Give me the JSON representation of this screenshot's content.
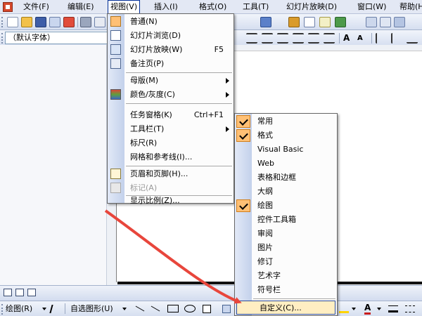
{
  "menubar": {
    "items": [
      {
        "label": "文件(F)"
      },
      {
        "label": "编辑(E)"
      },
      {
        "label": "视图(V)"
      },
      {
        "label": "插入(I)"
      },
      {
        "label": "格式(O)"
      },
      {
        "label": "工具(T)"
      },
      {
        "label": "幻灯片放映(D)"
      },
      {
        "label": "窗口(W)"
      },
      {
        "label": "帮助(H)"
      }
    ]
  },
  "formatting": {
    "font_name": "（默认字体）"
  },
  "view_menu": {
    "items": [
      {
        "label": "普通(N)",
        "shortcut": "",
        "icon": "normal-view-icon"
      },
      {
        "label": "幻灯片浏览(D)",
        "shortcut": "",
        "icon": "slide-sorter-icon"
      },
      {
        "label": "幻灯片放映(W)",
        "shortcut": "F5",
        "icon": "slide-show-icon"
      },
      {
        "label": "备注页(P)",
        "shortcut": "",
        "icon": "notes-page-icon"
      },
      {
        "label": "母版(M)",
        "shortcut": "",
        "icon": ""
      },
      {
        "label": "颜色/灰度(C)",
        "shortcut": "",
        "icon": "color-grayscale-icon"
      },
      {
        "label": "任务窗格(K)",
        "shortcut": "Ctrl+F1",
        "icon": ""
      },
      {
        "label": "工具栏(T)",
        "shortcut": "",
        "icon": ""
      },
      {
        "label": "标尺(R)",
        "shortcut": "",
        "icon": ""
      },
      {
        "label": "网格和参考线(I)...",
        "shortcut": "",
        "icon": ""
      },
      {
        "label": "页眉和页脚(H)...",
        "shortcut": "",
        "icon": "header-footer-icon"
      },
      {
        "label": "标记(A)",
        "shortcut": "",
        "icon": "markup-icon"
      },
      {
        "label": "显示比例(Z)...",
        "shortcut": "",
        "icon": ""
      }
    ]
  },
  "toolbars_submenu": {
    "items": [
      {
        "label": "常用",
        "checked": true
      },
      {
        "label": "格式",
        "checked": true
      },
      {
        "label": "Visual Basic",
        "checked": false
      },
      {
        "label": "Web",
        "checked": false
      },
      {
        "label": "表格和边框",
        "checked": false
      },
      {
        "label": "大纲",
        "checked": false
      },
      {
        "label": "绘图",
        "checked": true
      },
      {
        "label": "控件工具箱",
        "checked": false
      },
      {
        "label": "审阅",
        "checked": false
      },
      {
        "label": "图片",
        "checked": false
      },
      {
        "label": "修订",
        "checked": false
      },
      {
        "label": "艺术字",
        "checked": false
      },
      {
        "label": "符号栏",
        "checked": false
      }
    ],
    "customize_label": "自定义(C)..."
  },
  "drawing_toolbar": {
    "draw_label": "绘图(R)",
    "autoshapes_label": "自选图形(U)"
  },
  "colors": {
    "menu_highlight": "#ffeec2",
    "check_bg": "#ffc075",
    "annotation_arrow": "#e8463c"
  }
}
